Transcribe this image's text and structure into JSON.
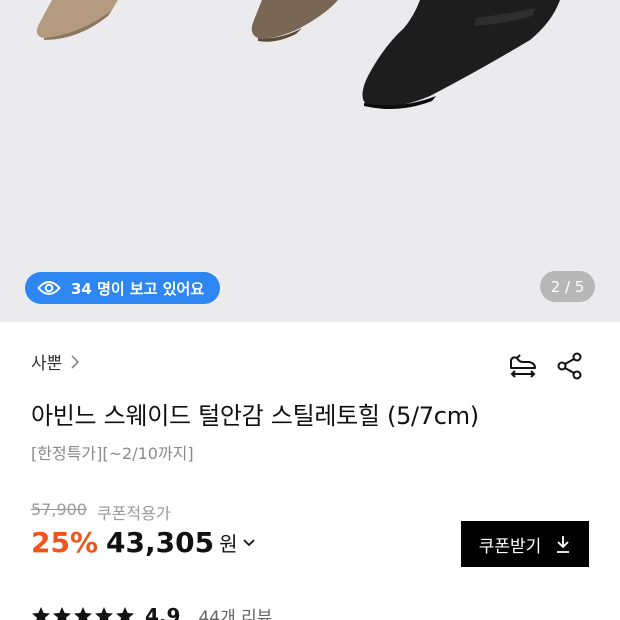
{
  "gallery": {
    "viewers_text": "34 명이 보고 있어요",
    "page_indicator": "2 / 5",
    "current_page": 2,
    "total_pages": 5
  },
  "product": {
    "brand": "사뿐",
    "title": "아빈느 스웨이드 털안감 스틸레토힐 (5/7cm)",
    "subtitle": "[한정특가][~2/10까지]"
  },
  "price": {
    "original": "57,900",
    "coupon_label": "쿠폰적용가",
    "discount": "25%",
    "sale": "43,305",
    "currency": "원"
  },
  "coupon_button": {
    "label": "쿠폰받기"
  },
  "review": {
    "rating": "4.9",
    "count_label": "44개 리뷰",
    "stars": 5
  },
  "colors": {
    "accent_blue": "#2e86f2",
    "discount_orange": "#f0541e",
    "gallery_bg": "#ebebed"
  },
  "icons": [
    "eye-icon",
    "chevron-right-icon",
    "size-guide-icon",
    "share-icon",
    "chevron-down-icon",
    "download-icon",
    "star-icon"
  ]
}
